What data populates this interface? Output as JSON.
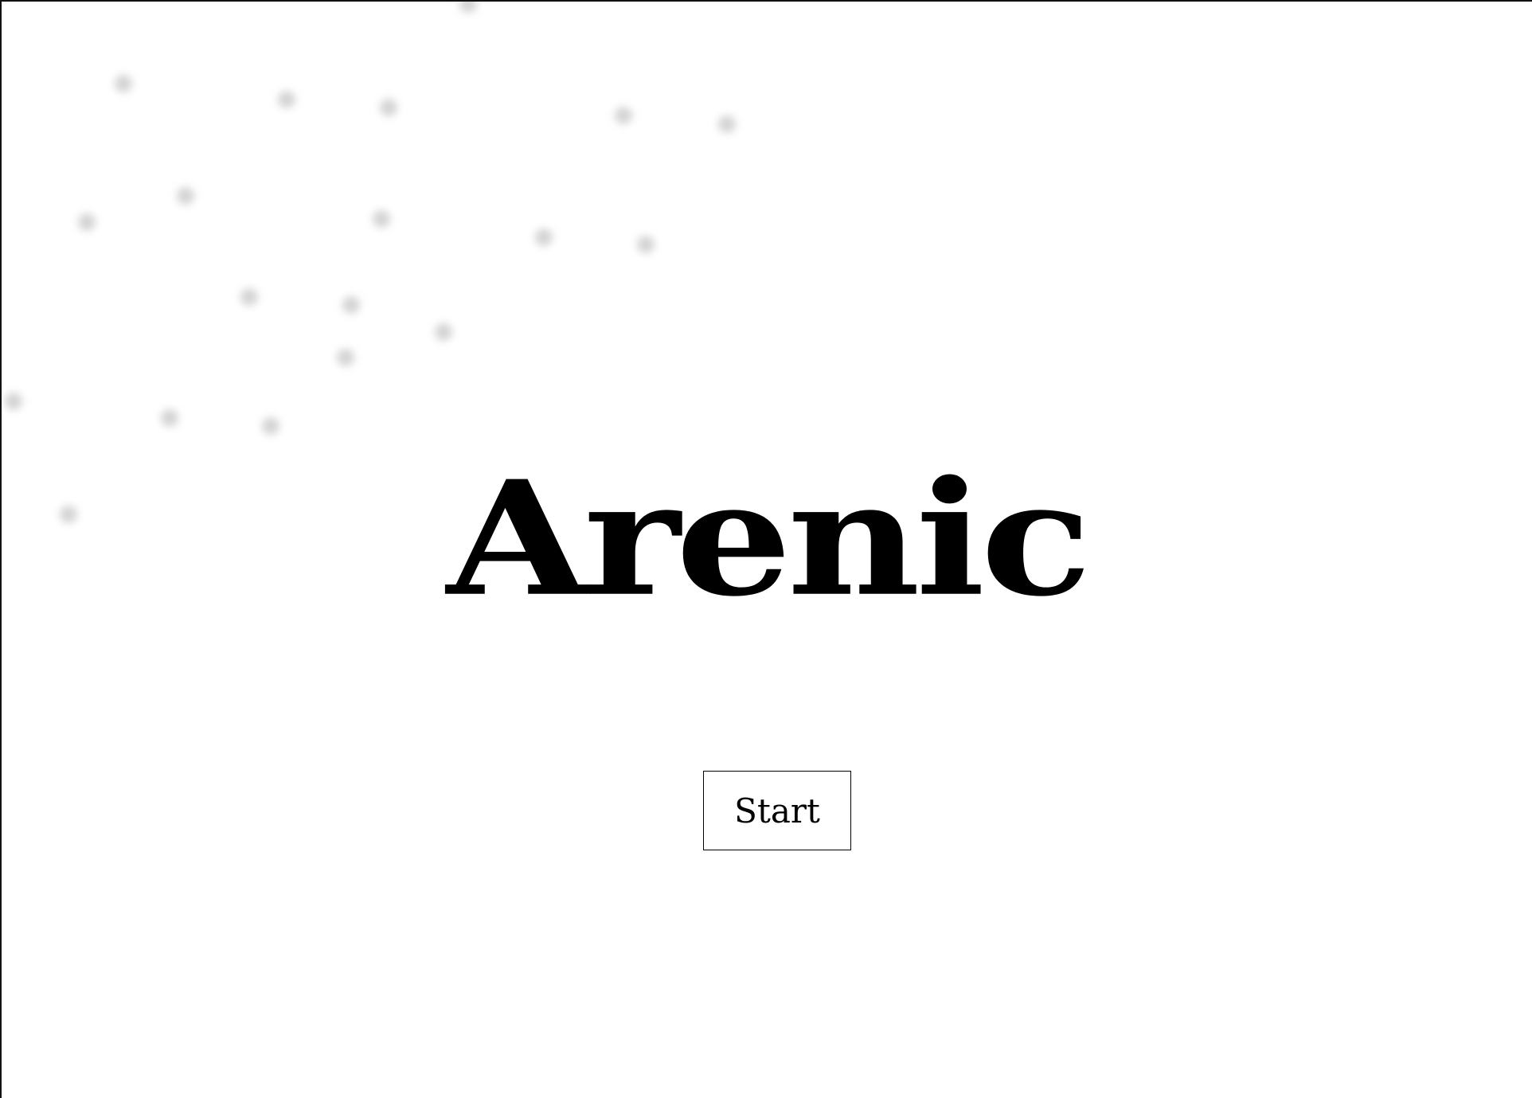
{
  "app": {
    "title": "Arenic"
  },
  "actions": {
    "start_label": "Start"
  },
  "colors": {
    "background": "#ffffff",
    "text": "#000000",
    "dot": "#d4d4d4"
  }
}
